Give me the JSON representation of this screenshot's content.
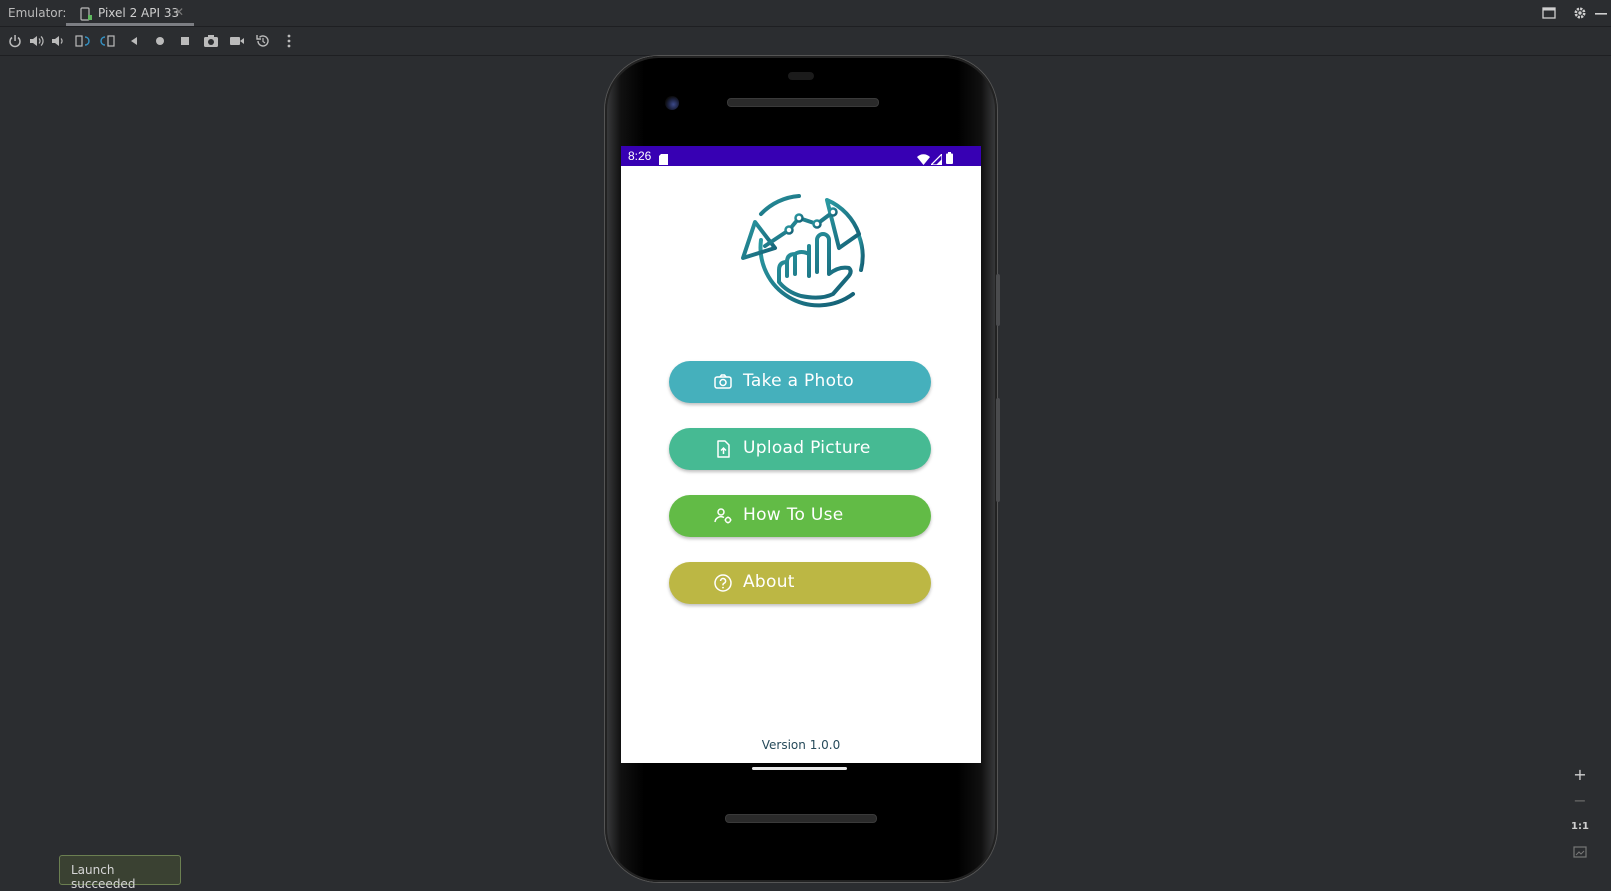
{
  "window": {
    "emulator_label": "Emulator:",
    "tab_title": "Pixel 2 API 33"
  },
  "toolbar": {
    "icons": [
      "power-icon",
      "volume-up-icon",
      "volume-down-icon",
      "rotate-left-icon",
      "rotate-right-icon",
      "back-icon",
      "home-icon",
      "overview-icon",
      "screenshot-icon",
      "screen-record-icon",
      "snapshot-icon",
      "more-icon"
    ]
  },
  "phone": {
    "status_time": "8:26",
    "app": {
      "buttons": [
        {
          "label": "Take a Photo",
          "color": "#45b0bc",
          "icon": "camera-icon"
        },
        {
          "label": "Upload Picture",
          "color": "#46ba93",
          "icon": "file-upload-icon"
        },
        {
          "label": "How To Use",
          "color": "#62bb46",
          "icon": "user-settings-icon"
        },
        {
          "label": "About",
          "color": "#bcb744",
          "icon": "help-circle-icon"
        }
      ],
      "version": "Version 1.0.0"
    }
  },
  "zoom": {
    "plus": "+",
    "minus": "−",
    "actual": "1:1"
  },
  "toast": {
    "message": "Launch succeeded"
  },
  "colors": {
    "ide_background": "#2b2d30",
    "status_bar": "#3700b3",
    "logo_gradient_start": "#2b9aa2",
    "logo_gradient_end": "#145e74"
  }
}
